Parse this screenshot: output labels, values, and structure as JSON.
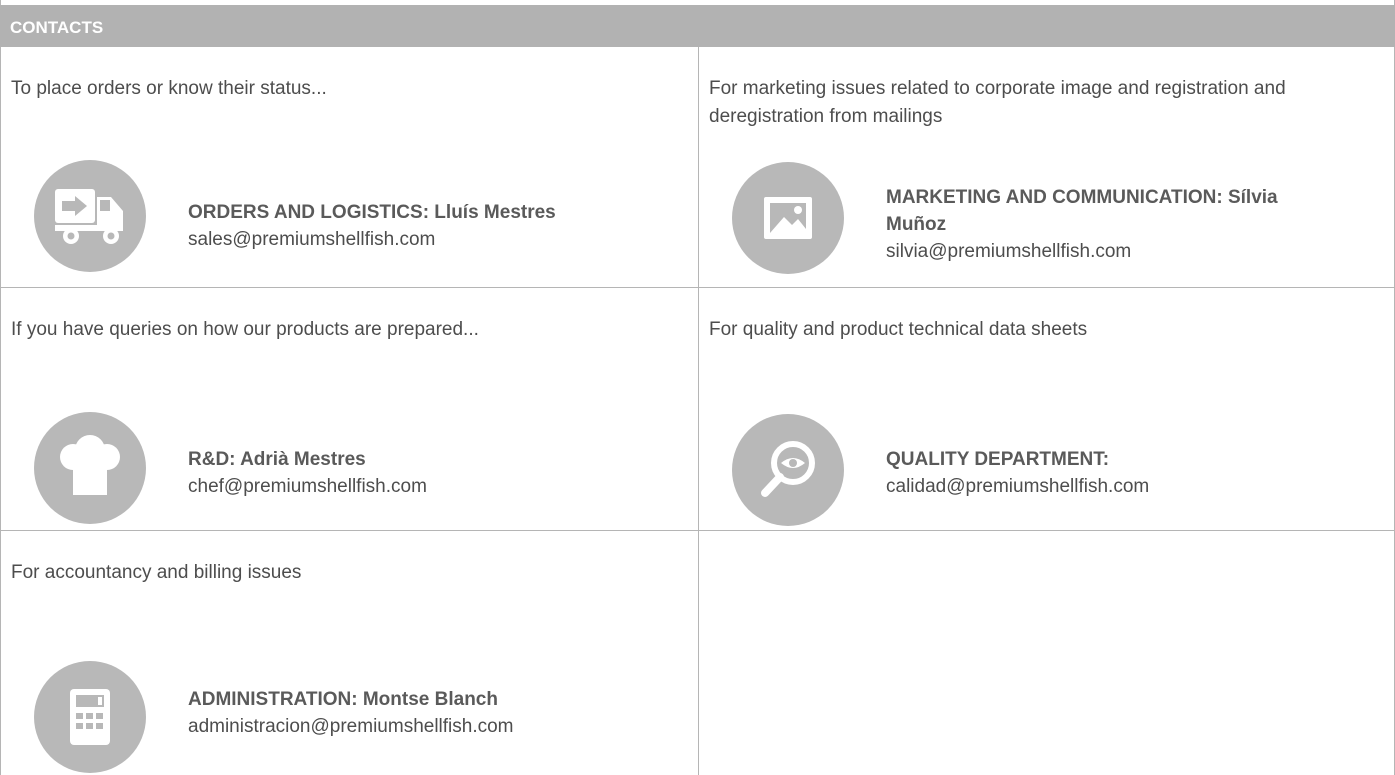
{
  "header": {
    "title": "CONTACTS"
  },
  "cells": [
    {
      "intro": "To place orders or know their status...",
      "icon": "delivery-truck-icon",
      "name": "ORDERS AND LOGISTICS: Lluís Mestres",
      "email": "sales@premiumshellfish.com"
    },
    {
      "intro": "For marketing issues related to corporate image and registration and deregistration from mailings",
      "icon": "image-icon",
      "name": "MARKETING AND COMMUNICATION: Sílvia Muñoz",
      "email": "silvia@premiumshellfish.com"
    },
    {
      "intro": "If you have queries on  how our products are prepared...",
      "icon": "chef-hat-icon",
      "name": "R&D: Adrià Mestres",
      "email": "chef@premiumshellfish.com"
    },
    {
      "intro": "For quality and product technical data sheets",
      "icon": "magnifier-eye-icon",
      "name": "QUALITY DEPARTMENT:",
      "email": "calidad@premiumshellfish.com"
    },
    {
      "intro": "For accountancy and billing issues",
      "icon": "calculator-icon",
      "name": "ADMINISTRATION: Montse Blanch",
      "email": "administracion@premiumshellfish.com"
    }
  ],
  "colors": {
    "header_bg": "#b2b2b2",
    "icon_bg": "#b8b8b8",
    "border": "#b5b5b5",
    "text": "#4d4d4d"
  }
}
